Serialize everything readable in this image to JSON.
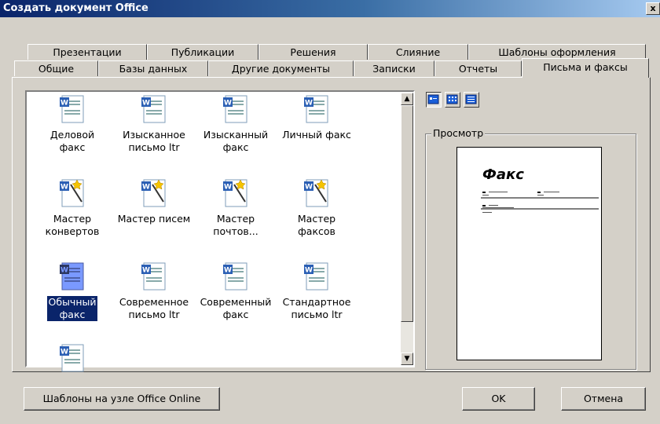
{
  "window": {
    "title": "Создать документ Office",
    "close_glyph": "x"
  },
  "tabs_back": [
    {
      "label": "Презентации"
    },
    {
      "label": "Публикации"
    },
    {
      "label": "Решения"
    },
    {
      "label": "Слияние"
    },
    {
      "label": "Шаблоны оформления"
    }
  ],
  "tabs_front": [
    {
      "label": "Общие"
    },
    {
      "label": "Базы данных"
    },
    {
      "label": "Другие документы"
    },
    {
      "label": "Записки"
    },
    {
      "label": "Отчеты"
    },
    {
      "label": "Письма и факсы",
      "active": true
    }
  ],
  "templates": [
    {
      "line1": "Деловой",
      "line2": "факс",
      "icon": "word-document-icon"
    },
    {
      "line1": "Изысканное",
      "line2": "письмо ltr",
      "icon": "word-document-icon"
    },
    {
      "line1": "Изысканный",
      "line2": "факс",
      "icon": "word-document-icon"
    },
    {
      "line1": "Личный факс",
      "line2": "",
      "icon": "word-document-icon"
    },
    {
      "line1": "Мастер",
      "line2": "конвертов",
      "icon": "word-wizard-icon"
    },
    {
      "line1": "Мастер писем",
      "line2": "",
      "icon": "word-wizard-icon"
    },
    {
      "line1": "Мастер",
      "line2": "почтов...",
      "icon": "word-wizard-icon"
    },
    {
      "line1": "Мастер",
      "line2": "факсов",
      "icon": "word-wizard-icon"
    },
    {
      "line1": "Обычный",
      "line2": "факс",
      "icon": "word-document-icon",
      "selected": true
    },
    {
      "line1": "Современное",
      "line2": "письмо ltr",
      "icon": "word-document-icon"
    },
    {
      "line1": "Современный",
      "line2": "факс",
      "icon": "word-document-icon"
    },
    {
      "line1": "Стандартное",
      "line2": "письмо ltr",
      "icon": "word-document-icon"
    },
    {
      "line1": "",
      "line2": "",
      "icon": "word-document-icon"
    }
  ],
  "preview": {
    "label": "Просмотр",
    "page_heading": "Факс"
  },
  "view_buttons": [
    "large-icons-view",
    "list-view",
    "details-view"
  ],
  "buttons": {
    "online": "Шаблоны на узле Office Online",
    "ok": "OK",
    "cancel": "Отмена"
  },
  "colors": {
    "titlebar": "#0a246a",
    "selection": "#0a246a",
    "face": "#d4d0c8"
  }
}
